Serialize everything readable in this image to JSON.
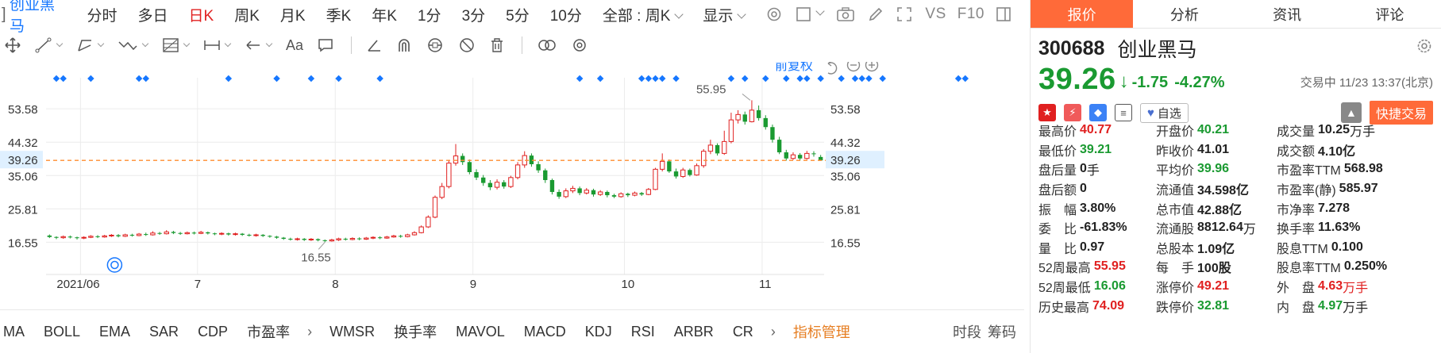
{
  "topbar": {
    "stock_name": "创业黑马",
    "periods": [
      "分时",
      "多日",
      "日K",
      "周K",
      "月K",
      "季K",
      "年K",
      "1分",
      "3分",
      "5分",
      "10分"
    ],
    "active_period": "日K",
    "range_select": "全部 : 周K",
    "display_select": "显示",
    "vs_label": "VS",
    "f10_label": "F10"
  },
  "chart": {
    "restoration_label": "前复权",
    "y_ticks": [
      "53.58",
      "44.32",
      "35.06",
      "25.81",
      "16.55"
    ],
    "current_price_label": "39.26",
    "x_labels": [
      "2021/06",
      "7",
      "8",
      "9",
      "10",
      "11"
    ],
    "high_annotation": "55.95",
    "low_annotation": "16.55",
    "colors": {
      "up": "#e02020",
      "down": "#1a9a31",
      "marker": "#1677ff",
      "price_line": "#ff8c2f"
    }
  },
  "chart_data": {
    "type": "candlestick",
    "title": "",
    "xlabel": "",
    "ylabel": "",
    "ylim": [
      12,
      60
    ],
    "current_price": 39.26,
    "high_point": 55.95,
    "low_point": 16.55,
    "months": [
      "2021/06",
      "7",
      "8",
      "9",
      "10",
      "11"
    ],
    "candles": [
      [
        18.4,
        18.0,
        18.7,
        17.7
      ],
      [
        18.0,
        17.8,
        18.2,
        17.4
      ],
      [
        17.8,
        18.1,
        18.4,
        17.5
      ],
      [
        18.1,
        17.9,
        18.4,
        17.6
      ],
      [
        17.9,
        17.7,
        18.1,
        17.3
      ],
      [
        17.7,
        17.9,
        18.2,
        17.4
      ],
      [
        17.9,
        18.2,
        18.5,
        17.7
      ],
      [
        18.2,
        18.0,
        18.5,
        17.7
      ],
      [
        18.0,
        18.3,
        18.6,
        17.8
      ],
      [
        18.3,
        18.5,
        18.8,
        18.0
      ],
      [
        18.5,
        18.2,
        18.8,
        17.9
      ],
      [
        18.2,
        18.6,
        18.9,
        18.0
      ],
      [
        18.6,
        18.4,
        18.9,
        18.1
      ],
      [
        18.4,
        18.8,
        19.1,
        18.2
      ],
      [
        18.8,
        18.6,
        19.2,
        18.3
      ],
      [
        18.6,
        19.1,
        19.6,
        18.4
      ],
      [
        19.1,
        18.9,
        19.4,
        18.6
      ],
      [
        18.9,
        19.4,
        19.9,
        18.7
      ],
      [
        19.4,
        19.1,
        19.7,
        18.8
      ],
      [
        19.1,
        18.9,
        19.4,
        18.6
      ],
      [
        18.9,
        19.2,
        19.5,
        18.7
      ],
      [
        19.2,
        19.0,
        19.5,
        18.7
      ],
      [
        19.0,
        19.3,
        19.7,
        18.8
      ],
      [
        19.3,
        19.0,
        19.5,
        18.7
      ],
      [
        19.0,
        18.8,
        19.2,
        18.5
      ],
      [
        18.8,
        19.0,
        19.3,
        18.5
      ],
      [
        19.0,
        18.7,
        19.2,
        18.4
      ],
      [
        18.7,
        18.9,
        19.2,
        18.4
      ],
      [
        18.9,
        18.6,
        19.1,
        18.3
      ],
      [
        18.6,
        18.4,
        18.9,
        18.1
      ],
      [
        18.4,
        18.6,
        18.9,
        18.1
      ],
      [
        18.6,
        18.3,
        18.8,
        18.0
      ],
      [
        18.3,
        18.1,
        18.5,
        17.8
      ],
      [
        18.1,
        17.8,
        18.3,
        17.5
      ],
      [
        17.8,
        17.5,
        18.0,
        17.2
      ],
      [
        17.5,
        17.3,
        17.8,
        17.0
      ],
      [
        17.3,
        17.5,
        17.8,
        17.0
      ],
      [
        17.5,
        17.2,
        17.7,
        16.9
      ],
      [
        17.2,
        17.4,
        17.7,
        16.9
      ],
      [
        17.4,
        17.1,
        17.6,
        16.8
      ],
      [
        17.1,
        16.9,
        17.3,
        16.55
      ],
      [
        16.9,
        17.2,
        17.5,
        16.7
      ],
      [
        17.2,
        17.5,
        17.8,
        16.9
      ],
      [
        17.5,
        17.3,
        17.8,
        17.0
      ],
      [
        17.3,
        17.6,
        17.9,
        17.1
      ],
      [
        17.6,
        17.4,
        17.9,
        17.1
      ],
      [
        17.4,
        17.7,
        18.0,
        17.2
      ],
      [
        17.7,
        17.9,
        18.2,
        17.4
      ],
      [
        17.9,
        17.7,
        18.2,
        17.4
      ],
      [
        17.7,
        18.0,
        18.3,
        17.5
      ],
      [
        18.0,
        18.3,
        18.6,
        17.8
      ],
      [
        18.3,
        18.1,
        18.6,
        17.8
      ],
      [
        18.1,
        18.6,
        18.9,
        17.9
      ],
      [
        18.6,
        19.2,
        19.6,
        18.4
      ],
      [
        19.2,
        20.8,
        21.2,
        19.0
      ],
      [
        20.8,
        23.5,
        24.0,
        20.5
      ],
      [
        23.5,
        29.0,
        29.5,
        23.2
      ],
      [
        29.0,
        32.0,
        33.0,
        28.5
      ],
      [
        32.0,
        38.5,
        39.2,
        31.5
      ],
      [
        38.5,
        40.5,
        43.8,
        37.8
      ],
      [
        40.5,
        38.8,
        41.2,
        38.0
      ],
      [
        38.8,
        36.0,
        39.5,
        35.4
      ],
      [
        36.0,
        34.5,
        36.8,
        33.8
      ],
      [
        34.5,
        33.0,
        35.2,
        32.2
      ],
      [
        33.0,
        31.8,
        33.8,
        31.0
      ],
      [
        31.8,
        33.2,
        34.0,
        31.2
      ],
      [
        33.2,
        32.0,
        33.8,
        31.4
      ],
      [
        32.0,
        34.5,
        35.0,
        31.6
      ],
      [
        34.5,
        38.0,
        38.8,
        34.0
      ],
      [
        38.0,
        40.6,
        41.8,
        37.2
      ],
      [
        40.6,
        38.2,
        41.2,
        37.5
      ],
      [
        38.2,
        36.5,
        39.0,
        35.8
      ],
      [
        36.5,
        33.8,
        37.0,
        33.0
      ],
      [
        33.8,
        30.5,
        34.2,
        29.8
      ],
      [
        30.5,
        29.2,
        31.2,
        28.6
      ],
      [
        29.2,
        30.8,
        31.5,
        28.8
      ],
      [
        30.8,
        31.5,
        32.2,
        30.2
      ],
      [
        31.5,
        30.2,
        32.0,
        29.6
      ],
      [
        30.2,
        31.0,
        31.6,
        29.8
      ],
      [
        31.0,
        29.8,
        31.4,
        29.2
      ],
      [
        29.8,
        30.5,
        31.0,
        29.4
      ],
      [
        30.5,
        29.6,
        30.9,
        29.0
      ],
      [
        29.6,
        29.2,
        30.0,
        28.8
      ],
      [
        29.2,
        30.0,
        30.4,
        28.9
      ],
      [
        30.0,
        29.6,
        30.3,
        29.1
      ],
      [
        29.6,
        30.2,
        30.6,
        29.3
      ],
      [
        30.2,
        29.8,
        30.5,
        29.4
      ],
      [
        29.8,
        31.2,
        31.6,
        29.6
      ],
      [
        31.2,
        36.8,
        37.2,
        31.0
      ],
      [
        36.8,
        39.0,
        41.2,
        36.2
      ],
      [
        39.0,
        36.2,
        39.5,
        35.8
      ],
      [
        36.2,
        34.8,
        37.0,
        34.2
      ],
      [
        34.8,
        36.6,
        37.2,
        34.4
      ],
      [
        36.6,
        35.2,
        37.0,
        34.8
      ],
      [
        35.2,
        37.8,
        38.4,
        35.0
      ],
      [
        37.8,
        41.8,
        42.4,
        37.2
      ],
      [
        41.8,
        43.5,
        45.0,
        41.0
      ],
      [
        43.5,
        41.2,
        44.0,
        40.6
      ],
      [
        41.2,
        44.5,
        47.5,
        40.8
      ],
      [
        44.5,
        50.5,
        52.5,
        44.0
      ],
      [
        50.5,
        52.0,
        53.2,
        49.5
      ],
      [
        52.0,
        50.0,
        52.8,
        49.2
      ],
      [
        50.0,
        53.2,
        55.95,
        49.8
      ],
      [
        53.2,
        51.0,
        54.5,
        50.3
      ],
      [
        51.0,
        48.5,
        51.8,
        47.8
      ],
      [
        48.5,
        45.0,
        49.2,
        44.2
      ],
      [
        45.0,
        41.5,
        45.8,
        41.0
      ],
      [
        41.5,
        39.8,
        42.2,
        39.2
      ],
      [
        39.8,
        40.8,
        41.5,
        39.4
      ],
      [
        40.8,
        39.8,
        41.3,
        39.2
      ],
      [
        39.8,
        41.2,
        41.9,
        39.5
      ],
      [
        41.2,
        41.0,
        41.8,
        40.3
      ],
      [
        40.21,
        39.26,
        40.77,
        39.21
      ]
    ],
    "marker_columns": [
      1,
      2,
      6,
      13,
      14,
      26,
      33,
      38,
      42,
      48,
      77,
      80,
      86,
      87,
      88,
      89,
      91,
      99,
      101,
      104,
      107,
      109,
      110,
      112,
      115,
      117,
      118,
      119,
      121,
      132,
      133
    ]
  },
  "indicators": [
    "MA",
    "BOLL",
    "EMA",
    "SAR",
    "CDP",
    "市盈率",
    "WMSR",
    "换手率",
    "MAVOL",
    "MACD",
    "KDJ",
    "RSI",
    "ARBR",
    "CR"
  ],
  "indicator_manage": "指标管理",
  "bottom_right": {
    "time_label": "时段",
    "filter_label": "筹码"
  },
  "tabs": [
    "报价",
    "分析",
    "资讯",
    "评论"
  ],
  "quote": {
    "code": "300688",
    "name": "创业黑马",
    "price": "39.26",
    "change": "-1.75",
    "change_pct": "-4.27%",
    "status": "交易中 11/23 13:37(北京)",
    "self_select": "自选",
    "quick_trade": "快捷交易",
    "rows": [
      [
        {
          "label": "最高价",
          "value": "40.77",
          "unit": "",
          "color": "red"
        },
        {
          "label": "开盘价",
          "value": "40.21",
          "unit": "",
          "color": "green"
        },
        {
          "label": "成交量",
          "value": "10.25",
          "unit": "万手",
          "color": ""
        }
      ],
      [
        {
          "label": "最低价",
          "value": "39.21",
          "unit": "",
          "color": "green"
        },
        {
          "label": "昨收价",
          "value": "41.01",
          "unit": "",
          "color": ""
        },
        {
          "label": "成交额",
          "value": "4.10亿",
          "unit": "",
          "color": ""
        }
      ],
      [
        {
          "label": "盘后量",
          "value": "0",
          "unit": "手",
          "color": ""
        },
        {
          "label": "平均价",
          "value": "39.96",
          "unit": "",
          "color": "green"
        },
        {
          "label": "市盈率TTM",
          "value": "568.98",
          "unit": "",
          "color": ""
        }
      ],
      [
        {
          "label": "盘后额",
          "value": "0",
          "unit": "",
          "color": ""
        },
        {
          "label": "流通值",
          "value": "34.598亿",
          "unit": "",
          "color": ""
        },
        {
          "label": "市盈率(静)",
          "value": "585.97",
          "unit": "",
          "color": ""
        }
      ],
      [
        {
          "label": "振　幅",
          "value": "3.80%",
          "unit": "",
          "color": ""
        },
        {
          "label": "总市值",
          "value": "42.88亿",
          "unit": "",
          "color": ""
        },
        {
          "label": "市净率",
          "value": "7.278",
          "unit": "",
          "color": ""
        }
      ],
      [
        {
          "label": "委　比",
          "value": "-61.83%",
          "unit": "",
          "color": ""
        },
        {
          "label": "流通股",
          "value": "8812.64",
          "unit": "万",
          "color": ""
        },
        {
          "label": "换手率",
          "value": "11.63%",
          "unit": "",
          "color": ""
        }
      ],
      [
        {
          "label": "量　比",
          "value": "0.97",
          "unit": "",
          "color": ""
        },
        {
          "label": "总股本",
          "value": "1.09亿",
          "unit": "",
          "color": ""
        },
        {
          "label": "股息TTM",
          "value": "0.100",
          "unit": "",
          "color": ""
        }
      ],
      [
        {
          "label": "52周最高",
          "value": "55.95",
          "unit": "",
          "color": "red"
        },
        {
          "label": "每　手",
          "value": "100股",
          "unit": "",
          "color": ""
        },
        {
          "label": "股息率TTM",
          "value": "0.250%",
          "unit": "",
          "color": ""
        }
      ],
      [
        {
          "label": "52周最低",
          "value": "16.06",
          "unit": "",
          "color": "green"
        },
        {
          "label": "涨停价",
          "value": "49.21",
          "unit": "",
          "color": "red"
        },
        {
          "label": "外　盘",
          "value": "4.63",
          "unit": "万手",
          "color": "red"
        }
      ],
      [
        {
          "label": "历史最高",
          "value": "74.09",
          "unit": "",
          "color": "red"
        },
        {
          "label": "跌停价",
          "value": "32.81",
          "unit": "",
          "color": "green"
        },
        {
          "label": "内　盘",
          "value": "4.97",
          "unit": "万手",
          "color": "green"
        }
      ]
    ]
  }
}
